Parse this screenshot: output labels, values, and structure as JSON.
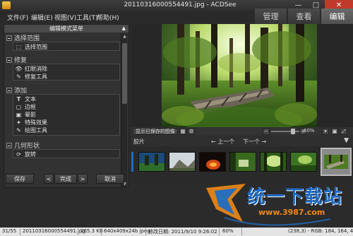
{
  "window": {
    "title": "20110316000554491.jpg - ACDSee"
  },
  "menu": {
    "items": [
      "文件(F)",
      "编辑(E)",
      "视图(V)",
      "工具(T)",
      "帮助(H)"
    ]
  },
  "modes": [
    {
      "label": "管理",
      "active": false
    },
    {
      "label": "查看",
      "active": false
    },
    {
      "label": "编辑",
      "active": true
    }
  ],
  "edit_panel": {
    "header": "编辑模式菜单",
    "sections": [
      {
        "title": "选择范围",
        "items": [
          {
            "label": "选择范围",
            "icon": "selection-icon"
          }
        ]
      },
      {
        "title": "修复",
        "items": [
          {
            "label": "红眼消除",
            "icon": "eye-icon"
          },
          {
            "label": "修复工具",
            "icon": "brush-icon"
          }
        ]
      },
      {
        "title": "添加",
        "items": [
          {
            "label": "文本",
            "icon": "text-icon"
          },
          {
            "label": "边框",
            "icon": "border-icon"
          },
          {
            "label": "晕影",
            "icon": "vignette-icon"
          },
          {
            "label": "特殊效果",
            "icon": "effects-icon"
          },
          {
            "label": "绘图工具",
            "icon": "draw-icon"
          }
        ]
      },
      {
        "title": "几何形状",
        "items": [
          {
            "label": "旋转",
            "icon": "rotate-icon"
          }
        ]
      }
    ],
    "buttons": {
      "save": "保存",
      "done": "完成",
      "cancel": "取消"
    }
  },
  "viewer_toolbar": {
    "show_saved": "显示已保存的图像",
    "zoom": "60%"
  },
  "filmstrip": {
    "label": "胶片",
    "prev": "上一个",
    "next": "下一个",
    "selected_index": 6
  },
  "status": {
    "index": "31/55",
    "filename": "20110316000554491.jpg",
    "size": "265.3 KB",
    "dims": "640x409x24b jpeg",
    "modified": "修改日期: 2011/9/10 9:26:02",
    "zoom": "60%",
    "pixel": "(238,3) - RGB: 184, 164, 49"
  },
  "watermark": {
    "brand": "统一下载站",
    "url": "www.3987.com"
  },
  "colors": {
    "accent_tab": "#5c5c5c",
    "close": "#c03a2b",
    "watermark_blue": "#1f6bc4",
    "watermark_orange": "#f08a16"
  }
}
